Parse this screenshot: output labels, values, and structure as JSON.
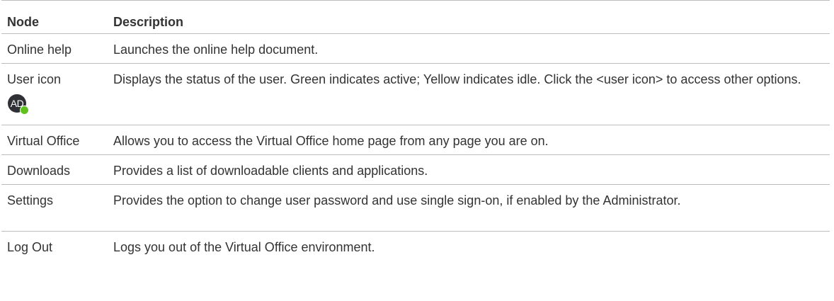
{
  "table": {
    "headers": {
      "node": "Node",
      "description": "Description"
    },
    "rows": [
      {
        "node": "Online help",
        "description": "Launches the online help document."
      },
      {
        "node": "User icon",
        "description": "Displays the status of the user. Green indicates active; Yellow indicates idle. Click the <user icon> to access other options.",
        "icon": {
          "name": "user-avatar-icon",
          "initials": "AD",
          "status_color": "#5fc21c",
          "avatar_color": "#2f3136"
        }
      },
      {
        "node": "Virtual Office",
        "description": "Allows you to access the Virtual Office home page from any page you are on."
      },
      {
        "node": "Downloads",
        "description": "Provides a list of downloadable clients and applications."
      },
      {
        "node": "Settings",
        "description": "Provides the option to change user password and use single sign-on, if enabled by the Administrator."
      },
      {
        "node": "Log Out",
        "description": "Logs you out of the Virtual Office environment."
      }
    ]
  }
}
